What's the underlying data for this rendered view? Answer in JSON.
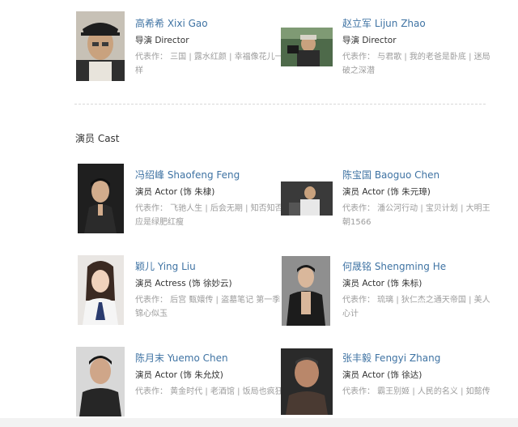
{
  "directors": [
    {
      "name": "高希希 Xixi Gao",
      "role": "导演 Director",
      "works": "代表作： 三国 | 露水红颜 | 幸福像花儿一样"
    },
    {
      "name": "赵立军 Lijun Zhao",
      "role": "导演 Director",
      "works": "代表作： 与君歌 | 我的老爸是卧底 | 迷局破之深潜"
    }
  ],
  "cast_section": {
    "title": "演员 Cast"
  },
  "cast": [
    {
      "name": "冯绍峰 Shaofeng Feng",
      "role": "演员 Actor (饰 朱棣)",
      "works": "代表作： 飞驰人生 | 后会无期 | 知否知否应是绿肥红瘦"
    },
    {
      "name": "陈宝国 Baoguo Chen",
      "role": "演员 Actor (饰 朱元璋)",
      "works": "代表作： 潘公河行动 | 宝贝计划 | 大明王朝1566"
    },
    {
      "name": "颖儿 Ying Liu",
      "role": "演员 Actress (饰 徐妙云)",
      "works": "代表作： 后宫 甄嬛传 | 盗墓笔记 第一季 | 锦心似玉"
    },
    {
      "name": "何晟铭 Shengming He",
      "role": "演员 Actor (饰 朱标)",
      "works": "代表作： 琉璃 | 狄仁杰之通天帝国 | 美人心计"
    },
    {
      "name": "陈月末 Yuemo Chen",
      "role": "演员 Actor (饰 朱允炆)",
      "works": "代表作： 黄金时代 | 老酒馆 | 饭局也疯狂"
    },
    {
      "name": "张丰毅 Fengyi Zhang",
      "role": "演员 Actor (饰 徐达)",
      "works": "代表作： 霸王别姬 | 人民的名义 | 如懿传"
    }
  ],
  "colors": {
    "link": "#3f73a3",
    "text": "#333333",
    "muted": "#9c9c9c",
    "divider": "#d8d8d8"
  }
}
